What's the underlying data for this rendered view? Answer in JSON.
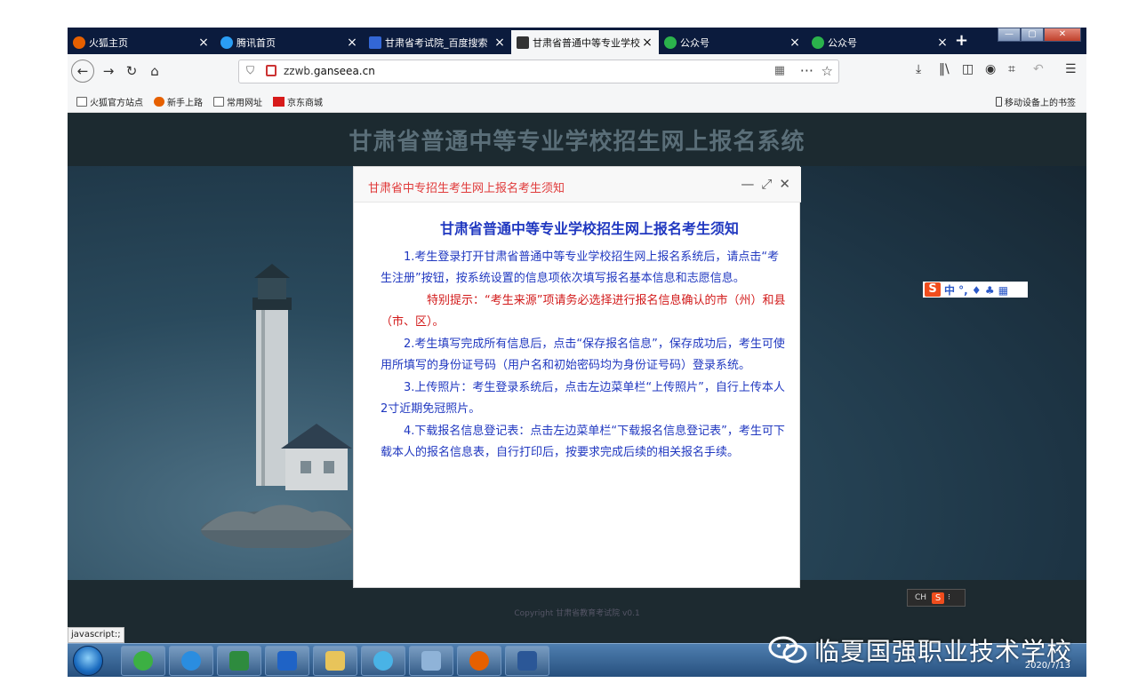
{
  "browser": {
    "tabs": [
      {
        "label": "火狐主页",
        "color": "#e66000",
        "active": false
      },
      {
        "label": "腾讯首页",
        "color": "#2a9df4",
        "active": false
      },
      {
        "label": "甘肃省考试院_百度搜索",
        "color": "#3367d6",
        "active": false
      },
      {
        "label": "甘肃省普通中等专业学校",
        "color": "#333333",
        "active": true
      },
      {
        "label": "公众号",
        "color": "#2bb24c",
        "active": false
      },
      {
        "label": "公众号",
        "color": "#2bb24c",
        "active": false
      }
    ],
    "url": {
      "prefix": "zzwb.",
      "domain": "ganseea.cn"
    },
    "bookmarks": [
      "火狐官方站点",
      "新手上路",
      "常用网址",
      "京东商城"
    ],
    "mobile_bookmarks": "移动设备上的书签"
  },
  "page": {
    "site_title": "甘肃省普通中等专业学校招生网上报名系统",
    "copyright": "Copyright 甘肃省教育考试院 v0.1"
  },
  "modal": {
    "title": "甘肃省中专招生考生网上报名考生须知",
    "heading": "甘肃省普通中等专业学校招生网上报名考生须知",
    "paragraphs": [
      "1.考生登录打开甘肃省普通中等专业学校招生网上报名系统后，请点击“考生注册”按钮，按系统设置的信息项依次填写报名基本信息和志愿信息。",
      "特别提示：“考生来源”项请务必选择进行报名信息确认的市（州）和县（市、区）。",
      "2.考生填写完成所有信息后，点击“保存报名信息”，保存成功后，考生可使用所填写的身份证号码（用户名和初始密码均为身份证号码）登录系统。",
      "3.上传照片：考生登录系统后，点击左边菜单栏“上传照片”，自行上传本人2寸近期免冠照片。",
      "4.下载报名信息登记表：点击左边菜单栏“下载报名信息登记表”，考生可下载本人的报名信息表，自行打印后，按要求完成后续的相关报名手续。"
    ]
  },
  "ime": {
    "widget_text": "中 °, ♦ ♣ ▦",
    "bar_label": "CH"
  },
  "statusbar": {
    "link": "javascript:;"
  },
  "taskbar": {
    "clock_date": "2020/7/13"
  },
  "watermark": {
    "text": "临夏国强职业技术学校"
  }
}
